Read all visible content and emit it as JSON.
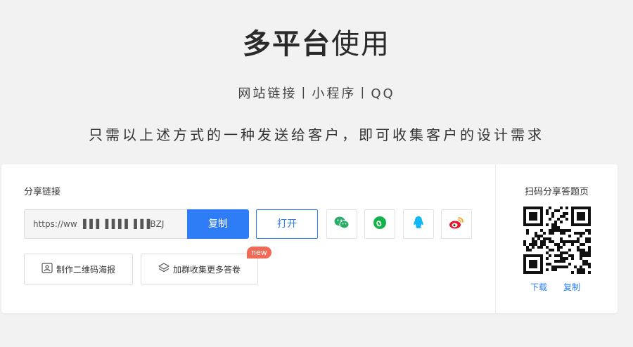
{
  "hero": {
    "title_bold": "多平台",
    "title_light": "使用",
    "platforms": "网站链接丨小程序丨QQ",
    "description": "只需以上述方式的一种发送给客户，即可收集客户的设计需求"
  },
  "share": {
    "label": "分享链接",
    "link_value": "https://ww  ▐▐▐ ▐▐▐▐ ▐▐▐BZJ",
    "copy_label": "复制",
    "open_label": "打开",
    "icons": [
      "wechat-icon",
      "mini-program-icon",
      "qq-icon",
      "weibo-icon"
    ],
    "poster_label": "制作二维码海报",
    "group_label": "加群收集更多答卷",
    "new_badge": "new"
  },
  "qr": {
    "title": "扫码分享答题页",
    "download_label": "下载",
    "copy_label": "复制"
  },
  "colors": {
    "accent": "#2f7df6",
    "wechat": "#2aae67",
    "mini_program": "#13b34b",
    "qq": "#12b7f5",
    "weibo": "#e6162d",
    "badge": "#f26a54"
  }
}
